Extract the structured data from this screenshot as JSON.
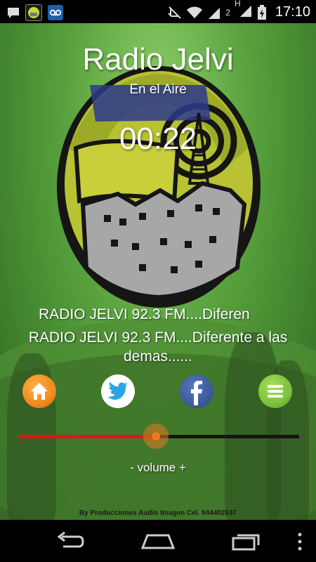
{
  "status_bar": {
    "time": "17:10",
    "signal_label": "2",
    "network_label": "H",
    "icons": [
      "chat-icon",
      "app-logo-icon",
      "voicemail-icon",
      "mute-icon",
      "wifi-icon",
      "signal-icon",
      "signal-icon",
      "battery-icon"
    ]
  },
  "player": {
    "title": "Radio Jelvi",
    "status": "En el Aire",
    "elapsed": "00:22",
    "marquee": "RADIO JELVI 92.3 FM....Diferen",
    "now_playing": "RADIO JELVI 92.3 FM....Diferente a las demas......",
    "volume_label": "- volume +",
    "volume_level": 0.49,
    "credits": "By Producciones Audio Imagen Cel. 944402637"
  },
  "actions": [
    {
      "name": "home-button",
      "icon": "home-icon"
    },
    {
      "name": "twitter-button",
      "icon": "twitter-icon"
    },
    {
      "name": "facebook-button",
      "icon": "facebook-icon"
    },
    {
      "name": "menu-button",
      "icon": "menu-icon"
    }
  ],
  "nav": {
    "buttons": [
      "back-icon",
      "home-icon",
      "recents-icon",
      "overflow-icon"
    ]
  },
  "colors": {
    "background": "#5aa33e",
    "slider_filled": "#e41414",
    "slider_empty": "#141414",
    "slider_thumb": "#f07820",
    "home_button": "#f28a1c",
    "twitter_button": "#ffffff",
    "facebook_button": "#3b5998",
    "menu_button": "#7cc23a"
  }
}
